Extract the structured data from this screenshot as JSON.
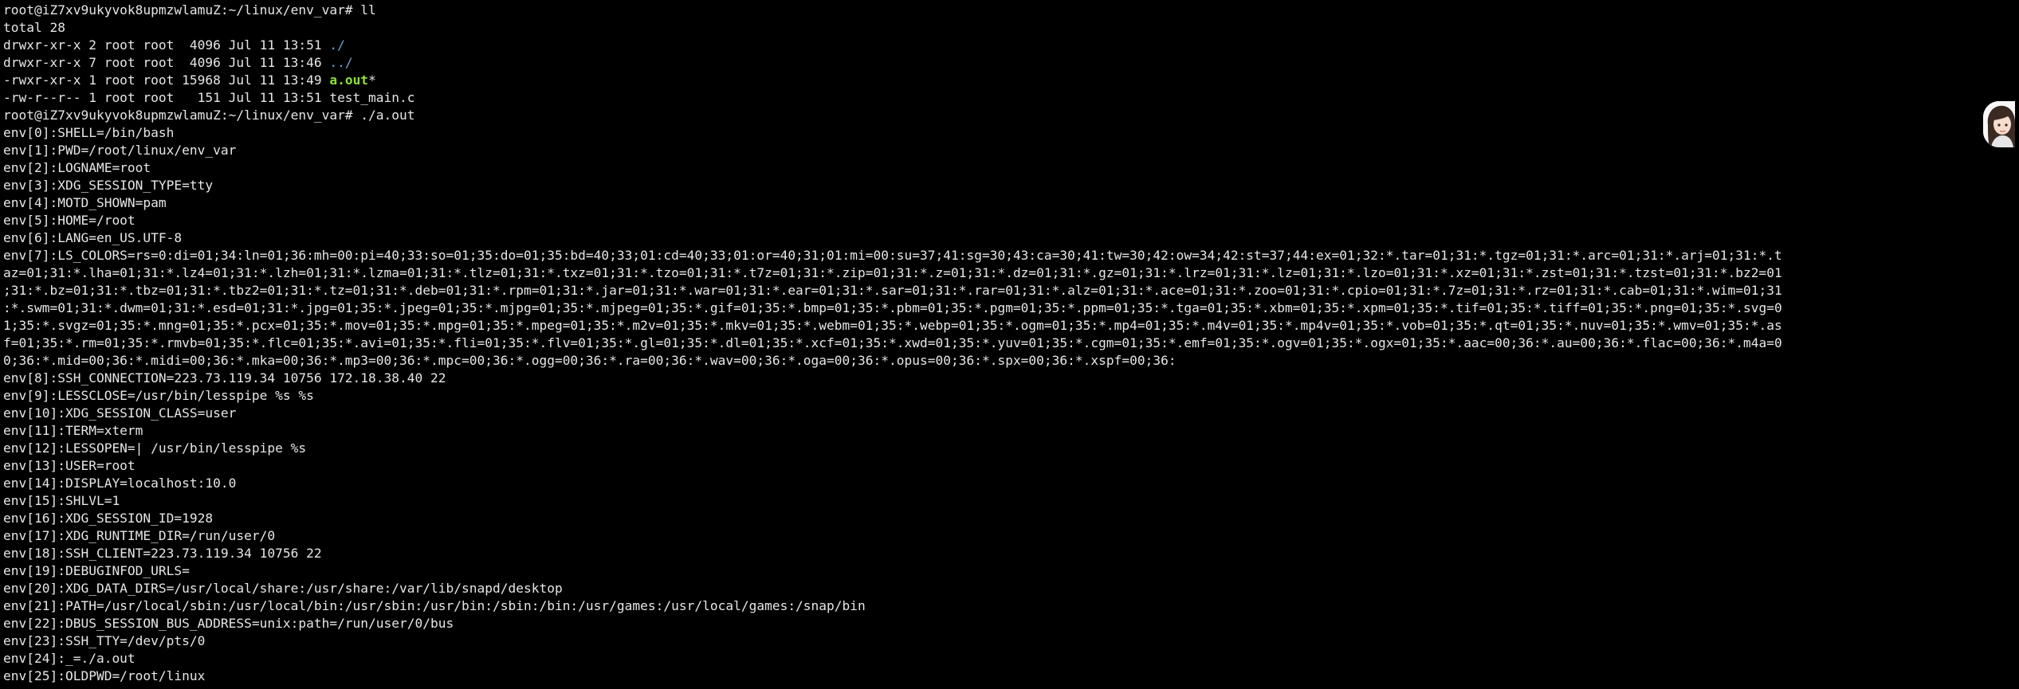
{
  "terminal": {
    "lines": [
      {
        "segments": [
          {
            "text": "root@iZ7xv9ukyvok8upmzwlamuZ:~/linux/env_var# ll"
          }
        ]
      },
      {
        "segments": [
          {
            "text": "total 28"
          }
        ]
      },
      {
        "segments": [
          {
            "text": "drwxr-xr-x 2 root root  4096 Jul 11 13:51 "
          },
          {
            "text": "./",
            "color": "blue"
          }
        ]
      },
      {
        "segments": [
          {
            "text": "drwxr-xr-x 7 root root  4096 Jul 11 13:46 "
          },
          {
            "text": "../",
            "color": "blue"
          }
        ]
      },
      {
        "segments": [
          {
            "text": "-rwxr-xr-x 1 root root 15968 Jul 11 13:49 "
          },
          {
            "text": "a.out",
            "color": "green"
          },
          {
            "text": "*"
          }
        ]
      },
      {
        "segments": [
          {
            "text": "-rw-r--r-- 1 root root   151 Jul 11 13:51 test_main.c"
          }
        ]
      },
      {
        "segments": [
          {
            "text": "root@iZ7xv9ukyvok8upmzwlamuZ:~/linux/env_var# ./a.out"
          }
        ]
      },
      {
        "segments": [
          {
            "text": "env[0]:SHELL=/bin/bash"
          }
        ]
      },
      {
        "segments": [
          {
            "text": "env[1]:PWD=/root/linux/env_var"
          }
        ]
      },
      {
        "segments": [
          {
            "text": "env[2]:LOGNAME=root"
          }
        ]
      },
      {
        "segments": [
          {
            "text": "env[3]:XDG_SESSION_TYPE=tty"
          }
        ]
      },
      {
        "segments": [
          {
            "text": "env[4]:MOTD_SHOWN=pam"
          }
        ]
      },
      {
        "segments": [
          {
            "text": "env[5]:HOME=/root"
          }
        ]
      },
      {
        "segments": [
          {
            "text": "env[6]:LANG=en_US.UTF-8"
          }
        ]
      },
      {
        "segments": [
          {
            "text": "env[7]:LS_COLORS=rs=0:di=01;34:ln=01;36:mh=00:pi=40;33:so=01;35:do=01;35:bd=40;33;01:cd=40;33;01:or=40;31;01:mi=00:su=37;41:sg=30;43:ca=30;41:tw=30;42:ow=34;42:st=37;44:ex=01;32:*.tar=01;31:*.tgz=01;31:*.arc=01;31:*.arj=01;31:*.t"
          }
        ]
      },
      {
        "segments": [
          {
            "text": "az=01;31:*.lha=01;31:*.lz4=01;31:*.lzh=01;31:*.lzma=01;31:*.tlz=01;31:*.txz=01;31:*.tzo=01;31:*.t7z=01;31:*.zip=01;31:*.z=01;31:*.dz=01;31:*.gz=01;31:*.lrz=01;31:*.lz=01;31:*.lzo=01;31:*.xz=01;31:*.zst=01;31:*.tzst=01;31:*.bz2=01"
          }
        ]
      },
      {
        "segments": [
          {
            "text": ";31:*.bz=01;31:*.tbz=01;31:*.tbz2=01;31:*.tz=01;31:*.deb=01;31:*.rpm=01;31:*.jar=01;31:*.war=01;31:*.ear=01;31:*.sar=01;31:*.rar=01;31:*.alz=01;31:*.ace=01;31:*.zoo=01;31:*.cpio=01;31:*.7z=01;31:*.rz=01;31:*.cab=01;31:*.wim=01;31"
          }
        ]
      },
      {
        "segments": [
          {
            "text": ":*.swm=01;31:*.dwm=01;31:*.esd=01;31:*.jpg=01;35:*.jpeg=01;35:*.mjpg=01;35:*.mjpeg=01;35:*.gif=01;35:*.bmp=01;35:*.pbm=01;35:*.pgm=01;35:*.ppm=01;35:*.tga=01;35:*.xbm=01;35:*.xpm=01;35:*.tif=01;35:*.tiff=01;35:*.png=01;35:*.svg=0"
          }
        ]
      },
      {
        "segments": [
          {
            "text": "1;35:*.svgz=01;35:*.mng=01;35:*.pcx=01;35:*.mov=01;35:*.mpg=01;35:*.mpeg=01;35:*.m2v=01;35:*.mkv=01;35:*.webm=01;35:*.webp=01;35:*.ogm=01;35:*.mp4=01;35:*.m4v=01;35:*.mp4v=01;35:*.vob=01;35:*.qt=01;35:*.nuv=01;35:*.wmv=01;35:*.as"
          }
        ]
      },
      {
        "segments": [
          {
            "text": "f=01;35:*.rm=01;35:*.rmvb=01;35:*.flc=01;35:*.avi=01;35:*.fli=01;35:*.flv=01;35:*.gl=01;35:*.dl=01;35:*.xcf=01;35:*.xwd=01;35:*.yuv=01;35:*.cgm=01;35:*.emf=01;35:*.ogv=01;35:*.ogx=01;35:*.aac=00;36:*.au=00;36:*.flac=00;36:*.m4a=0"
          }
        ]
      },
      {
        "segments": [
          {
            "text": "0;36:*.mid=00;36:*.midi=00;36:*.mka=00;36:*.mp3=00;36:*.mpc=00;36:*.ogg=00;36:*.ra=00;36:*.wav=00;36:*.oga=00;36:*.opus=00;36:*.spx=00;36:*.xspf=00;36:"
          }
        ]
      },
      {
        "segments": [
          {
            "text": "env[8]:SSH_CONNECTION=223.73.119.34 10756 172.18.38.40 22"
          }
        ]
      },
      {
        "segments": [
          {
            "text": "env[9]:LESSCLOSE=/usr/bin/lesspipe %s %s"
          }
        ]
      },
      {
        "segments": [
          {
            "text": "env[10]:XDG_SESSION_CLASS=user"
          }
        ]
      },
      {
        "segments": [
          {
            "text": "env[11]:TERM=xterm"
          }
        ]
      },
      {
        "segments": [
          {
            "text": "env[12]:LESSOPEN=| /usr/bin/lesspipe %s"
          }
        ]
      },
      {
        "segments": [
          {
            "text": "env[13]:USER=root"
          }
        ]
      },
      {
        "segments": [
          {
            "text": "env[14]:DISPLAY=localhost:10.0"
          }
        ]
      },
      {
        "segments": [
          {
            "text": "env[15]:SHLVL=1"
          }
        ]
      },
      {
        "segments": [
          {
            "text": "env[16]:XDG_SESSION_ID=1928"
          }
        ]
      },
      {
        "segments": [
          {
            "text": "env[17]:XDG_RUNTIME_DIR=/run/user/0"
          }
        ]
      },
      {
        "segments": [
          {
            "text": "env[18]:SSH_CLIENT=223.73.119.34 10756 22"
          }
        ]
      },
      {
        "segments": [
          {
            "text": "env[19]:DEBUGINFOD_URLS="
          }
        ]
      },
      {
        "segments": [
          {
            "text": "env[20]:XDG_DATA_DIRS=/usr/local/share:/usr/share:/var/lib/snapd/desktop"
          }
        ]
      },
      {
        "segments": [
          {
            "text": "env[21]:PATH=/usr/local/sbin:/usr/local/bin:/usr/sbin:/usr/bin:/sbin:/bin:/usr/games:/usr/local/games:/snap/bin"
          }
        ]
      },
      {
        "segments": [
          {
            "text": "env[22]:DBUS_SESSION_BUS_ADDRESS=unix:path=/run/user/0/bus"
          }
        ]
      },
      {
        "segments": [
          {
            "text": "env[23]:SSH_TTY=/dev/pts/0"
          }
        ]
      },
      {
        "segments": [
          {
            "text": "env[24]:_=./a.out"
          }
        ]
      },
      {
        "segments": [
          {
            "text": "env[25]:OLDPWD=/root/linux"
          }
        ]
      }
    ]
  },
  "avatar": {
    "icon": "user-avatar-icon"
  },
  "colors": {
    "background": "#000000",
    "text": "#e6e6e6",
    "executable": "#8ae234",
    "directory": "#729fcf"
  }
}
